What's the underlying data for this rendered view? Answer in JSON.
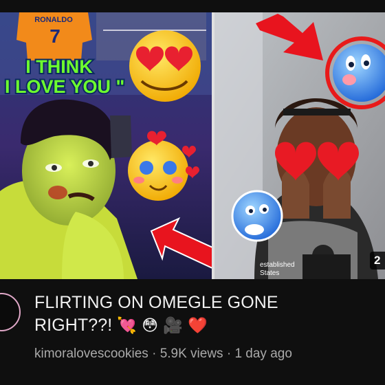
{
  "thumbnail": {
    "jersey_text": "RONALDO",
    "jersey_number": "7",
    "caption_line1": "I THINK",
    "caption_line2": "\" I LOVE YOU \"",
    "overlay_text_line1": "established",
    "overlay_text_line2": "States",
    "accent_green": "#6eff2e",
    "arrow_red": "#e8141e",
    "ring_red": "#e81a1a"
  },
  "duration": "2",
  "video": {
    "title_line1": "FLIRTING ON OMEGLE GONE",
    "title_line2": "RIGHT??!",
    "title_emojis": [
      "💘",
      "😳",
      "🎥",
      "❤️"
    ],
    "channel": "kimoralovescookies",
    "views": "5.9K views",
    "age": "1 day ago",
    "separator": "·"
  }
}
